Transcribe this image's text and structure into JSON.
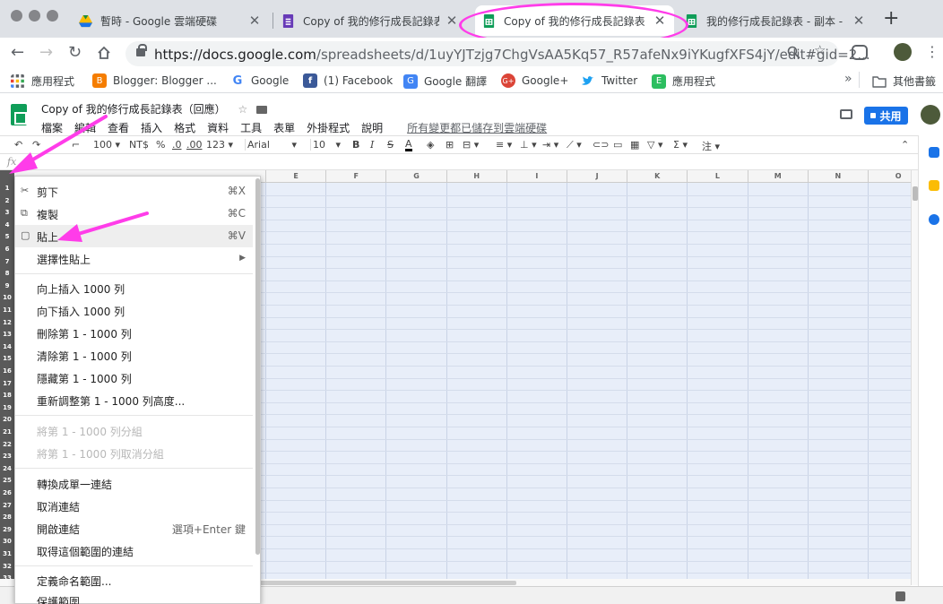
{
  "browser": {
    "tabs": [
      {
        "title": "暫時 - Google 雲端硬碟",
        "icon": "google-drive-icon"
      },
      {
        "title": "Copy of 我的修行成長記錄表",
        "icon": "google-forms-icon"
      },
      {
        "title": "Copy of 我的修行成長記錄表",
        "icon": "google-sheets-icon",
        "active": true
      },
      {
        "title": "我的修行成長記錄表 - 副本 -",
        "icon": "google-sheets-icon"
      }
    ],
    "new_tab": "+",
    "url_host": "https://docs.google.com",
    "url_path": "/spreadsheets/d/1uyYJTzjg7ChgVsAA5Kq57_R57afeNx9iYKugfXFS4jY/edit#gid=2...",
    "bookmarks": [
      {
        "label": "應用程式",
        "icon": "apps-grid-icon"
      },
      {
        "label": "Blogger: Blogger ...",
        "icon": "blogger-icon",
        "color": "#f57d00"
      },
      {
        "label": "Google",
        "icon": "google-icon",
        "color": "#4285f4"
      },
      {
        "label": "(1) Facebook",
        "icon": "facebook-icon",
        "color": "#3b5998"
      },
      {
        "label": "Google 翻譯",
        "icon": "google-translate-icon",
        "color": "#4285f4"
      },
      {
        "label": "Google+",
        "icon": "google-plus-icon",
        "color": "#db4437"
      },
      {
        "label": "Twitter",
        "icon": "twitter-icon",
        "color": "#1da1f2"
      },
      {
        "label": "應用程式",
        "icon": "evernote-icon",
        "color": "#2dbe60"
      }
    ],
    "bookmarks_overflow": "»",
    "other_bookmarks": "其他書籤"
  },
  "sheet": {
    "title": "Copy of 我的修行成長記錄表（回應）",
    "menus": [
      "檔案",
      "編輯",
      "查看",
      "插入",
      "格式",
      "資料",
      "工具",
      "表單",
      "外掛程式",
      "說明"
    ],
    "save_status": "所有變更都已儲存到雲端硬碟",
    "share_label": "共用",
    "toolbar": {
      "zoom": "100",
      "currency": "NT$",
      "percent": "%",
      "dec_less": ".0",
      "dec_more": ".00",
      "format_more": "123",
      "font": "Arial",
      "font_size": "10",
      "bold": "B",
      "italic": "I",
      "strike": "S",
      "text_color": "A",
      "sigma": "Σ",
      "note": "注"
    },
    "fx_label": "fx",
    "columns": [
      "E",
      "F",
      "G",
      "H",
      "I",
      "J",
      "K",
      "L",
      "M",
      "N",
      "O"
    ],
    "rows": [
      "1",
      "2",
      "3",
      "4",
      "5",
      "6",
      "7",
      "8",
      "9",
      "10",
      "11",
      "12",
      "13",
      "14",
      "15",
      "16",
      "17",
      "18",
      "19",
      "20",
      "21",
      "22",
      "23",
      "24",
      "25",
      "26",
      "27",
      "28",
      "29",
      "30",
      "31",
      "32",
      "33"
    ]
  },
  "context_menu": {
    "items": [
      {
        "label": "剪下",
        "shortcut": "⌘X",
        "icon": "scissors-icon"
      },
      {
        "label": "複製",
        "shortcut": "⌘C",
        "icon": "copy-icon"
      },
      {
        "label": "貼上",
        "shortcut": "⌘V",
        "icon": "paste-icon",
        "highlighted": true
      },
      {
        "label": "選擇性貼上",
        "shortcut": "▶"
      },
      {
        "label": "向上插入 1000 列"
      },
      {
        "label": "向下插入 1000 列"
      },
      {
        "label": "刪除第 1 - 1000 列"
      },
      {
        "label": "清除第 1 - 1000 列"
      },
      {
        "label": "隱藏第 1 - 1000 列"
      },
      {
        "label": "重新調整第 1 - 1000 列高度..."
      },
      {
        "label": "將第 1 - 1000 列分組",
        "disabled": true
      },
      {
        "label": "將第 1 - 1000 列取消分組",
        "disabled": true
      },
      {
        "label": "轉換成單一連結"
      },
      {
        "label": "取消連結"
      },
      {
        "label": "開啟連結",
        "shortcut": "選項+Enter 鍵"
      },
      {
        "label": "取得這個範圍的連結"
      },
      {
        "label": "定義命名範圍..."
      },
      {
        "label": "保護範圍"
      }
    ]
  },
  "annotation_color": "#ff3ce9"
}
